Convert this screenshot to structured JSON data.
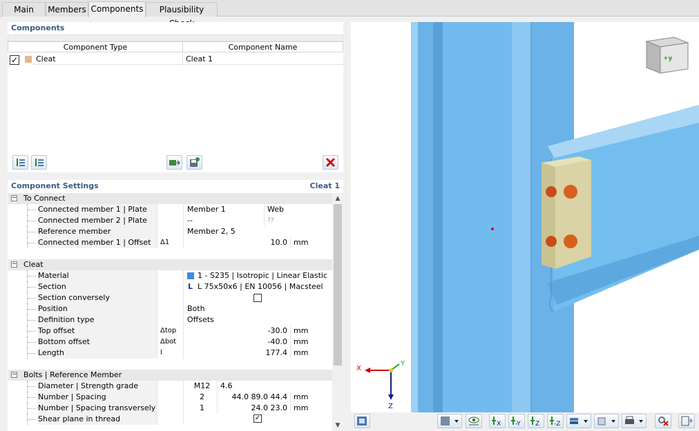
{
  "tabs": [
    "Main",
    "Members",
    "Components",
    "Plausibility Check"
  ],
  "active_tab": "Components",
  "components": {
    "title": "Components",
    "col_type": "Component Type",
    "col_name": "Component Name",
    "rows": [
      {
        "checked": true,
        "type": "Cleat",
        "name": "Cleat 1",
        "color": "#e2b98a"
      }
    ]
  },
  "settings": {
    "title": "Component Settings",
    "current": "Cleat 1",
    "groups": [
      {
        "name": "To Connect",
        "rows": [
          {
            "label": "Connected member 1 | Plate",
            "sym": "",
            "v1": "Member 1",
            "v2": "Web",
            "unit": ""
          },
          {
            "label": "Connected member 2 | Plate",
            "sym": "",
            "v1": "--",
            "v2": "??",
            "unit": ""
          },
          {
            "label": "Reference member",
            "sym": "",
            "v1": "Member 2, 5",
            "v2": "",
            "unit": ""
          },
          {
            "label": "Connected member 1 | Offset",
            "sym": "Δ1",
            "v1": "",
            "v2": "10.0",
            "unit": "mm"
          }
        ]
      },
      {
        "name": "Cleat",
        "rows": [
          {
            "label": "Material",
            "sym": "",
            "v1": "1 - S235 | Isotropic | Linear Elastic",
            "v2": "",
            "unit": ""
          },
          {
            "label": "Section",
            "sym": "",
            "v1": "L 75x50x6 | EN 10056 | Macsteel",
            "v2": "",
            "unit": ""
          },
          {
            "label": "Section conversely",
            "sym": "",
            "v1": "",
            "v2": "",
            "unit": ""
          },
          {
            "label": "Position",
            "sym": "",
            "v1": "Both",
            "v2": "",
            "unit": ""
          },
          {
            "label": "Definition type",
            "sym": "",
            "v1": "Offsets",
            "v2": "",
            "unit": ""
          },
          {
            "label": "Top offset",
            "sym": "Δtop",
            "v1": "",
            "v2": "-30.0",
            "unit": "mm"
          },
          {
            "label": "Bottom offset",
            "sym": "Δbot",
            "v1": "",
            "v2": "-40.0",
            "unit": "mm"
          },
          {
            "label": "Length",
            "sym": "l",
            "v1": "",
            "v2": "177.4",
            "unit": "mm"
          }
        ]
      },
      {
        "name": "Bolts | Reference Member",
        "rows": [
          {
            "label": "Diameter | Strength grade",
            "sym": "",
            "v1": "M12",
            "v2": "4.6",
            "unit": ""
          },
          {
            "label": "Number | Spacing longitudinally",
            "sym": "",
            "v1": "2",
            "v2": "44.0 89.0 44.4",
            "unit": "mm"
          },
          {
            "label": "Number | Spacing transversely",
            "sym": "",
            "v1": "1",
            "v2": "24.0 23.0",
            "unit": "mm"
          },
          {
            "label": "Shear plane in thread",
            "sym": "",
            "v1": "",
            "v2": "",
            "unit": ""
          }
        ]
      }
    ]
  },
  "viewport": {
    "cube_label": "+y",
    "axis_x": "X",
    "axis_y": "Y",
    "axis_z": "Z"
  }
}
